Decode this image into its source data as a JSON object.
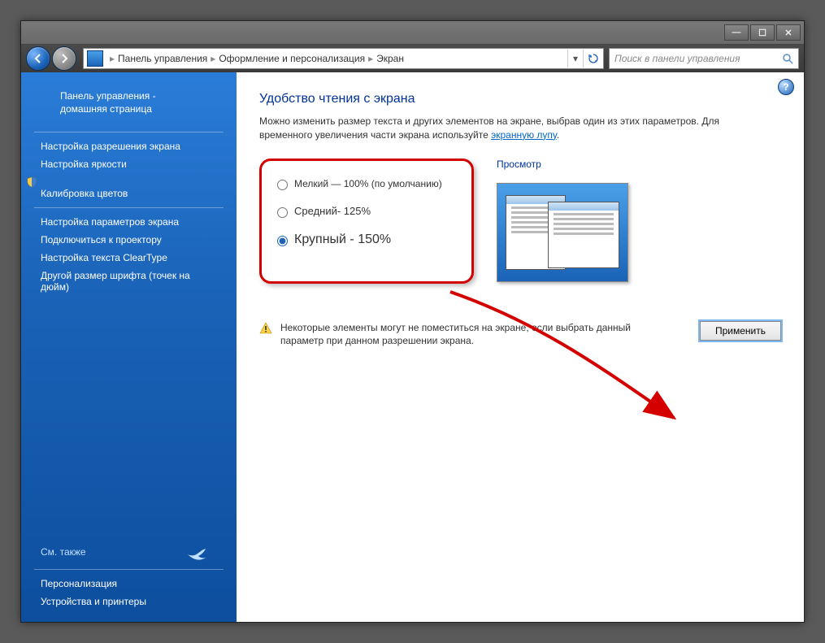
{
  "breadcrumb": {
    "root": "Панель управления",
    "mid": "Оформление и персонализация",
    "leaf": "Экран"
  },
  "search": {
    "placeholder": "Поиск в панели управления"
  },
  "sidebar": {
    "home": "Панель управления - домашняя страница",
    "items": [
      "Настройка разрешения экрана",
      "Настройка яркости",
      "Калибровка цветов",
      "Настройка параметров экрана",
      "Подключиться к проектору",
      "Настройка текста ClearType",
      "Другой размер шрифта (точек на дюйм)"
    ],
    "seeAlsoLabel": "См. также",
    "seeAlso": [
      "Персонализация",
      "Устройства и принтеры"
    ]
  },
  "main": {
    "title": "Удобство чтения с экрана",
    "desc_a": "Можно изменить размер текста и других элементов на экране, выбрав один из этих параметров. Для временного увеличения части экрана используйте ",
    "desc_link": "экранную лупу",
    "desc_b": ".",
    "options": [
      "Мелкий — 100% (по умолчанию)",
      "Средний- 125%",
      "Крупный - 150%"
    ],
    "selected": 2,
    "previewLabel": "Просмотр",
    "warning": "Некоторые элементы могут не поместиться на экране, если выбрать данный параметр при данном разрешении экрана.",
    "applyLabel": "Применить"
  }
}
